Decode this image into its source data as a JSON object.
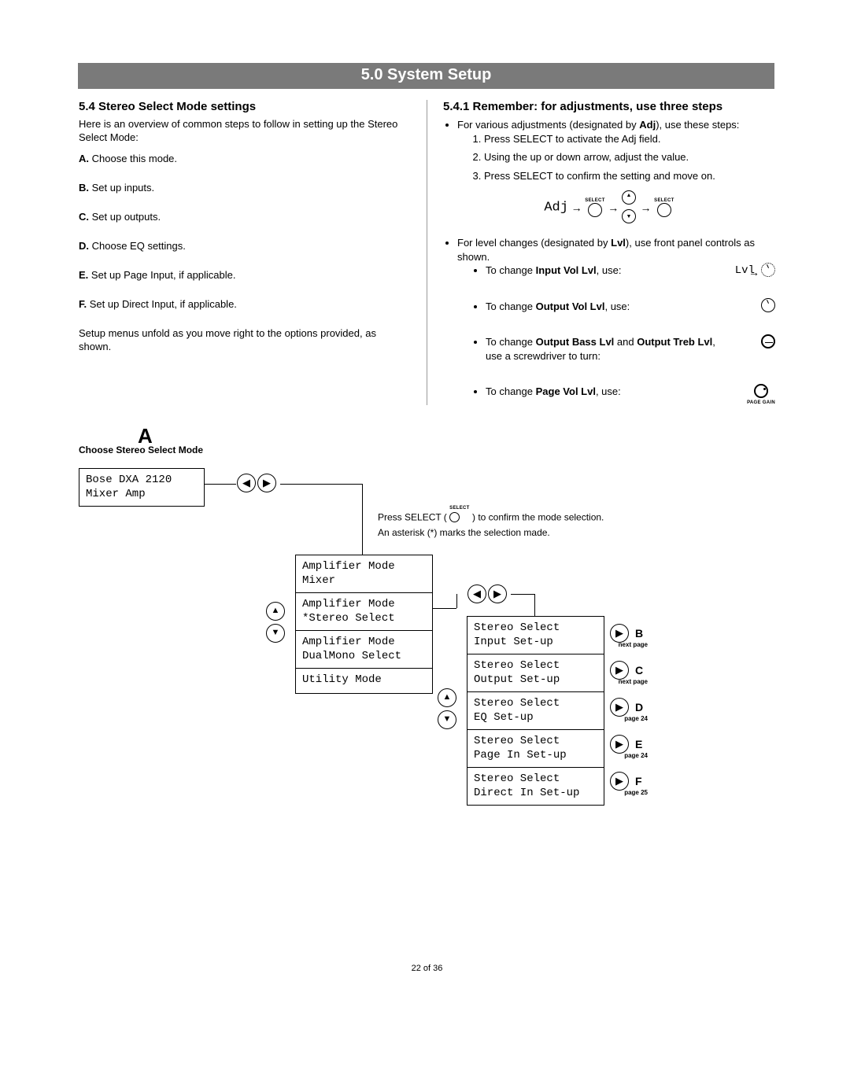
{
  "banner": "5.0 System Setup",
  "left": {
    "heading": "5.4 Stereo Select Mode settings",
    "intro": "Here is an overview of common steps to follow in setting up the Stereo Select Mode:",
    "steps": [
      {
        "l": "A.",
        "t": "Choose this mode."
      },
      {
        "l": "B.",
        "t": "Set up inputs."
      },
      {
        "l": "C.",
        "t": "Set up outputs."
      },
      {
        "l": "D.",
        "t": "Choose EQ settings."
      },
      {
        "l": "E.",
        "t": "Set up Page Input, if applicable."
      },
      {
        "l": "F.",
        "t": "Set up Direct Input, if applicable."
      }
    ],
    "closing": "Setup menus unfold as you move right to the options provided, as shown."
  },
  "right": {
    "heading": "5.4.1 Remember: for adjustments, use three steps",
    "adj_intro_a": "For various adjustments (designated by ",
    "adj_bold": "Adj",
    "adj_intro_b": "), use these steps:",
    "adj_steps": [
      "Press SELECT to activate the Adj field.",
      "Using the up or down arrow, adjust the value.",
      "Press SELECT to confirm the setting and move on."
    ],
    "adj_label": "Adj",
    "select_tiny": "SELECT",
    "lvl_intro_a": "For level changes (designated by ",
    "lvl_bold": "Lvl",
    "lvl_intro_b": "), use front panel controls as shown.",
    "lvl_items": [
      {
        "pre": "To change ",
        "b": "Input Vol Lvl",
        "post": ", use:",
        "pref": "Lvl",
        "cap": ""
      },
      {
        "pre": "To change ",
        "b": "Output Vol Lvl",
        "post": ", use:",
        "pref": "",
        "cap": ""
      },
      {
        "pre": "To change ",
        "b": "Output Bass Lvl",
        "post_a": " and ",
        "b2": "Output Treb Lvl",
        "post": ", use a screwdriver to turn:",
        "pref": "",
        "cap": ""
      },
      {
        "pre": "To change ",
        "b": "Page Vol Lvl",
        "post": ", use:",
        "pref": "",
        "cap": "PAGE GAIN"
      }
    ]
  },
  "flow": {
    "letterA": "A",
    "title": "Choose Stereo Select Mode",
    "box1_l1": "Bose DXA 2120",
    "box1_l2": "Mixer Amp",
    "confirm_a": "Press SELECT (",
    "confirm_b": ") to confirm the mode selection.",
    "confirm_c": "An asterisk (*) marks the selection made.",
    "select_tiny": "SELECT",
    "modes": [
      {
        "l1": "Amplifier Mode",
        "l2": " Mixer"
      },
      {
        "l1": "Amplifier Mode",
        "l2": "*Stereo Select"
      },
      {
        "l1": "Amplifier Mode",
        "l2": " DualMono Select"
      },
      {
        "l1": "Utility Mode",
        "l2": ""
      }
    ],
    "subs": [
      {
        "l1": "Stereo Select",
        "l2": "Input Set-up",
        "letter": "B",
        "note": "next page"
      },
      {
        "l1": "Stereo Select",
        "l2": "Output Set-up",
        "letter": "C",
        "note": "next page"
      },
      {
        "l1": "Stereo Select",
        "l2": "EQ Set-up",
        "letter": "D",
        "note": "page 24"
      },
      {
        "l1": "Stereo Select",
        "l2": "Page In Set-up",
        "letter": "E",
        "note": "page 24"
      },
      {
        "l1": "Stereo Select",
        "l2": "Direct In Set-up",
        "letter": "F",
        "note": "page 25"
      }
    ]
  },
  "footer": "22 of 36"
}
